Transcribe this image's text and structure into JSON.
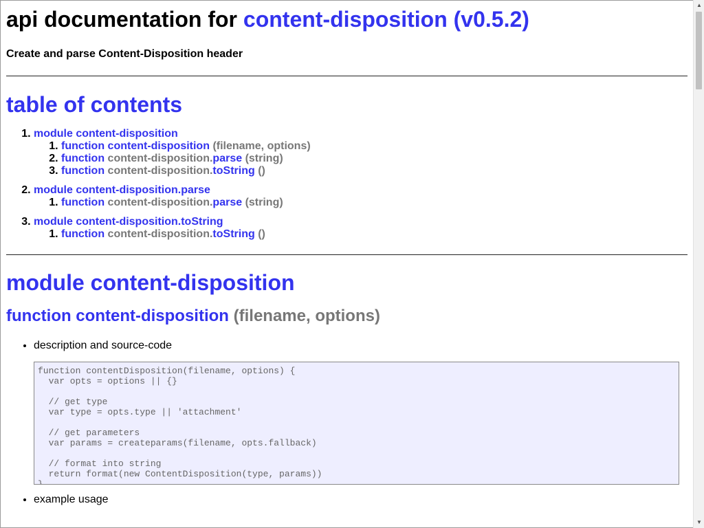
{
  "header": {
    "title_prefix": "api documentation for ",
    "title_link": "content-disposition (v0.5.2)",
    "subtitle": "Create and parse Content-Disposition header"
  },
  "toc": {
    "heading": "table of contents",
    "modules": [
      {
        "label": "module content-disposition",
        "functions": [
          {
            "kw": "function",
            "name_gray": "",
            "name_link": "content-disposition",
            "args": "(filename, options)"
          },
          {
            "kw": "function",
            "name_gray": "content-disposition.",
            "name_link": "parse",
            "args": "(string)"
          },
          {
            "kw": "function",
            "name_gray": "content-disposition.",
            "name_link": "toString",
            "args": "()"
          }
        ]
      },
      {
        "label": "module content-disposition.parse",
        "functions": [
          {
            "kw": "function",
            "name_gray": "content-disposition.",
            "name_link": "parse",
            "args": "(string)"
          }
        ]
      },
      {
        "label": "module content-disposition.toString",
        "functions": [
          {
            "kw": "function",
            "name_gray": "content-disposition.",
            "name_link": "toString",
            "args": "()"
          }
        ]
      }
    ]
  },
  "module_section": {
    "heading": "module content-disposition",
    "function_heading": "function content-disposition",
    "function_args": "(filename, options)",
    "items": {
      "description_label": "description and source-code",
      "example_label": "example usage"
    },
    "source_code": "function contentDisposition(filename, options) {\n  var opts = options || {}\n\n  // get type\n  var type = opts.type || 'attachment'\n\n  // get parameters\n  var params = createparams(filename, opts.fallback)\n\n  // format into string\n  return format(new ContentDisposition(type, params))\n}"
  },
  "scrollbar": {
    "up_icon": "▲",
    "down_icon": "▼"
  }
}
